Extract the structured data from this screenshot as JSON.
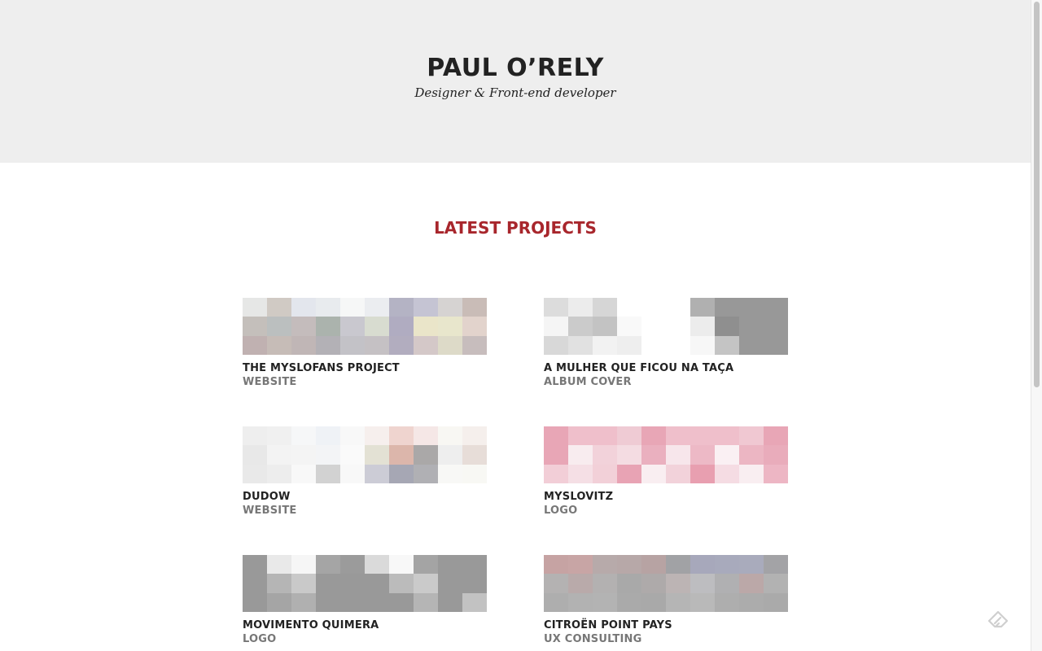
{
  "header": {
    "title": "PAUL O’RELY",
    "tagline": "Designer & Front-end developer"
  },
  "section": {
    "title": "LATEST PROJECTS"
  },
  "projects": [
    {
      "name": "THE MYSLOFANS PROJECT",
      "type": "WEBSITE",
      "thumb_colors": [
        "#e6e7e6",
        "#d0cac4",
        "#e3e6ed",
        "#e8ebee",
        "#f6f7f7",
        "#ebedf0",
        "#b4b3c4",
        "#c5c4d3",
        "#d6d3d2",
        "#c9bcb7",
        "#c4bfbb",
        "#bbbfbf",
        "#c4bcbc",
        "#abb3ad",
        "#c9c8cf",
        "#d8dcd0",
        "#b0acc1",
        "#eae5c9",
        "#e8e6cc",
        "#e2d3cc",
        "#c0b1b1",
        "#c6bcb7",
        "#c0b6b6",
        "#b3b1b6",
        "#c3c2c7",
        "#c5c1c4",
        "#b2adbf",
        "#d4c8c8",
        "#dddac8",
        "#c7bdbd"
      ]
    },
    {
      "name": "A MULHER QUE FICOU NA TAÇA",
      "type": "ALBUM COVER",
      "thumb_colors": [
        "#dcdcdc",
        "#ececec",
        "#d6d6d6",
        "#ffffff",
        "#ffffff",
        "#ffffff",
        "#b0b0b0",
        "#989898",
        "#989898",
        "#989898",
        "#f5f5f5",
        "#cbcbcb",
        "#c3c3c3",
        "#f9f9f9",
        "#ffffff",
        "#ffffff",
        "#ececec",
        "#8f8f8f",
        "#989898",
        "#989898",
        "#d8d8d8",
        "#e1e1e1",
        "#f2f2f2",
        "#eeeeee",
        "#ffffff",
        "#ffffff",
        "#f7f7f7",
        "#c4c4c4",
        "#989898",
        "#989898"
      ]
    },
    {
      "name": "DUDOW",
      "type": "WEBSITE",
      "thumb_colors": [
        "#eeeeee",
        "#f0f0f0",
        "#f6f7f8",
        "#eff2f6",
        "#f8f8f8",
        "#f6efed",
        "#efd4cf",
        "#f5e7e6",
        "#f8f7f3",
        "#f5efec",
        "#e8e8e8",
        "#f3f3f3",
        "#f4f4f4",
        "#f3f4f6",
        "#fafafa",
        "#e3e1d4",
        "#dcb6ab",
        "#aaa8a8",
        "#eeeeee",
        "#e7ddd8",
        "#e9e9e9",
        "#ededed",
        "#f8f8f8",
        "#d2d2d2",
        "#f8f8f8",
        "#ccccd6",
        "#a6a7b4",
        "#b0b0b4",
        "#f8f8f6",
        "#f8f8f4"
      ]
    },
    {
      "name": "MYSLOVITZ",
      "type": "LOGO",
      "thumb_colors": [
        "#e8a6b6",
        "#efbfcb",
        "#efbfcb",
        "#efcbd4",
        "#e8a6b6",
        "#efbfcb",
        "#efbfcb",
        "#efbfcb",
        "#f0c8d2",
        "#e8a6b6",
        "#e8a6b6",
        "#f8ecef",
        "#f2d2da",
        "#f4dce2",
        "#eab0bf",
        "#f7e6eb",
        "#edb9c6",
        "#faf0f3",
        "#ecb6c3",
        "#e9acbb",
        "#f2ced7",
        "#f5dfe5",
        "#f2d0d8",
        "#e8a3b4",
        "#f9eef1",
        "#f2d2da",
        "#e89fb0",
        "#f5dce3",
        "#f9eef1",
        "#edb6c4"
      ]
    },
    {
      "name": "MOVIMENTO QUIMERA",
      "type": "LOGO",
      "thumb_colors": [
        "#999999",
        "#e9e9e9",
        "#f6f6f6",
        "#a5a5a5",
        "#9b9b9b",
        "#dadada",
        "#f8f8f8",
        "#a4a4a4",
        "#999999",
        "#999999",
        "#999999",
        "#b5b5b5",
        "#c9c9c9",
        "#999999",
        "#999999",
        "#999999",
        "#bbbbbb",
        "#cacaca",
        "#999999",
        "#999999",
        "#999999",
        "#a5a5a5",
        "#b0b0b0",
        "#999999",
        "#999999",
        "#999999",
        "#999999",
        "#b5b5b5",
        "#999999",
        "#c2c2c2"
      ]
    },
    {
      "name": "CITROËN POINT PAYS",
      "type": "UX CONSULTING",
      "thumb_colors": [
        "#c6a3a3",
        "#c8a5a5",
        "#b7aaaa",
        "#b7a8a8",
        "#b7a3a3",
        "#a1a2a5",
        "#a7a8bb",
        "#a8aabc",
        "#a9abbc",
        "#a3a3a6",
        "#b4b2b2",
        "#b9aaaa",
        "#b3b1b1",
        "#a9a9a9",
        "#aeaaaa",
        "#bcb4b4",
        "#bdbdc0",
        "#b0b0b2",
        "#bba8a8",
        "#b2b2b2",
        "#aeaeae",
        "#b2b2b2",
        "#b3b3b3",
        "#aaaaaa",
        "#a9a9a9",
        "#b5b5b5",
        "#b9b9b9",
        "#aeaeae",
        "#acacac",
        "#aaaaaa"
      ]
    }
  ]
}
